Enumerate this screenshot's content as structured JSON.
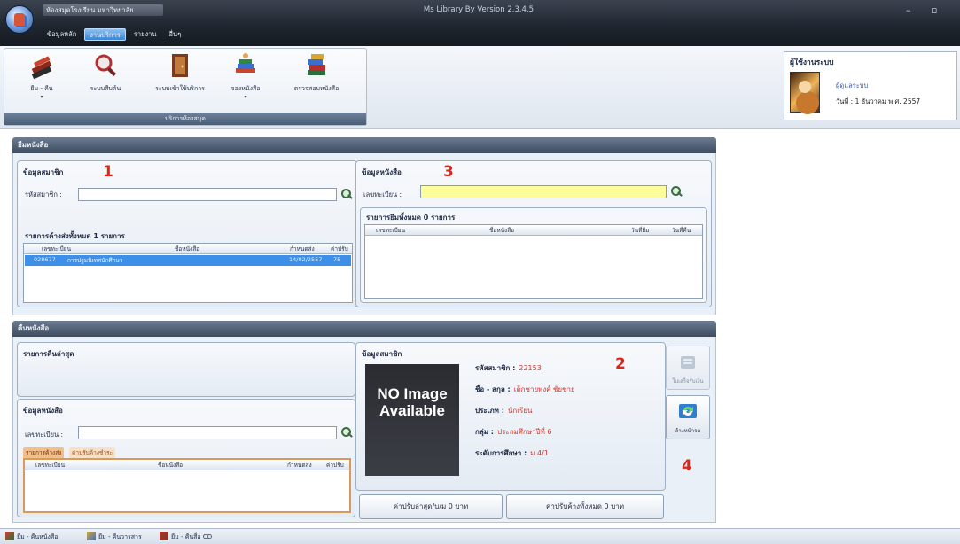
{
  "titlebar": {
    "doc_title": "ห้องสมุดโรงเรียน มหาวิทยาลัย",
    "window_title": "Ms Library By Version 2.3.4.5",
    "minimize": "–",
    "maximize": "▫",
    "tabs": [
      "ข้อมูลหลัก",
      "งานบริการ",
      "รายงาน",
      "อื่นๆ"
    ]
  },
  "ribbon": {
    "buttons": [
      {
        "label": "ยืม - คืน",
        "icon": "books-icon"
      },
      {
        "label": "ระบบสืบค้น",
        "icon": "magnifier-icon"
      },
      {
        "label": "ระบบเข้าใช้บริการ",
        "icon": "door-icon"
      },
      {
        "label": "จองหนังสือ",
        "icon": "reading-icon"
      },
      {
        "label": "ตรวจสอบหนังสือ",
        "icon": "book-stack-icon"
      }
    ],
    "group_label": "บริการห้องสมุด"
  },
  "user": {
    "title": "ผู้ใช้งานระบบ",
    "name": "ผู้ดูแลระบบ",
    "date": "วันที่ : 1  ธันวาคม พ.ศ. 2557"
  },
  "borrow": {
    "section_title": "ยืมหนังสือ",
    "member": {
      "title": "ข้อมูลสมาชิก",
      "marker": "1",
      "id_label": "รหัสสมาชิก :",
      "id_value": ""
    },
    "pending": {
      "title": "รายการค้างส่งทั้งหมด 1 รายการ",
      "columns": [
        "เลขทะเบียน",
        "ชื่อหนังสือ",
        "กำหนดส่ง",
        "ค่าปรับ"
      ],
      "rows": [
        [
          "028677",
          "การปฐมนิเทศนักศึกษา",
          "14/02/2557",
          "75"
        ]
      ]
    },
    "book": {
      "title": "ข้อมูลหนังสือ",
      "marker": "3",
      "reg_label": "เลขทะเบียน :",
      "reg_value": ""
    },
    "borrowed": {
      "title": "รายการยืมทั้งหมด 0 รายการ",
      "columns": [
        "เลขทะเบียน",
        "ชื่อหนังสือ",
        "วันที่ยืม",
        "วันที่คืน"
      ]
    }
  },
  "return": {
    "section_title": "คืนหนังสือ",
    "latest": {
      "title": "รายการคืนล่าสุด"
    },
    "book": {
      "title": "ข้อมูลหนังสือ",
      "reg_label": "เลขทะเบียน :",
      "reg_value": "",
      "tabs": [
        "รายการค้างส่ง",
        "ค่าปรับค้างชำระ"
      ],
      "columns": [
        "เลขทะเบียน",
        "ชื่อหนังสือ",
        "กำหนดส่ง",
        "ค่าปรับ"
      ]
    },
    "member": {
      "title": "ข้อมูลสมาชิก",
      "marker": "2",
      "photo_text": "NO Image Available",
      "fields": [
        {
          "label": "รหัสสมาชิก :",
          "value": "22153"
        },
        {
          "label": "ชื่อ - สกุล :",
          "value": "เด็กชายพงศ์ ชัยชาย"
        },
        {
          "label": "ประเภท :",
          "value": "นักเรียน"
        },
        {
          "label": "กลุ่ม :",
          "value": "ประถมศึกษาปีที่ 6"
        },
        {
          "label": "ระดับการศึกษา :",
          "value": "ม.4/1"
        }
      ]
    },
    "fine_latest": "ค่าปรับล่าสุด/บ/ม 0 บาท",
    "fine_total": "ค่าปรับค้างทั้งหมด 0 บาท",
    "side": {
      "receipt_label": "ใบเสร็จรับเงิน",
      "marker": "4",
      "refresh_label": "ล้างหน้าจอ"
    }
  },
  "statusbar": {
    "tabs": [
      "ยืม - คืนหนังสือ",
      "ยืม - คืนวารสาร",
      "ยืม - คืนสื่อ CD"
    ]
  },
  "colors": {
    "accent_blue": "#3d8fe8",
    "marker_red": "#e02418",
    "value_red": "#d4372c",
    "input_yellow": "#fefd9b"
  }
}
